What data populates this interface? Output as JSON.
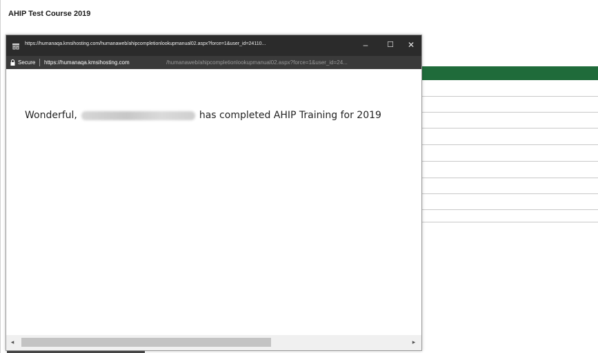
{
  "page": {
    "title": "AHIP Test Course 2019"
  },
  "popup": {
    "titlebar_url": "https://humanaqa.kmsihosting.com/humanaweb/ahipcompletionlookupmanual02.aspx?force=1&user_id=24110...",
    "minimize_glyph": "–",
    "maximize_glyph": "☐",
    "close_glyph": "✕",
    "secure_label": "Secure",
    "address_host": "https://humanaqa.kmsihosting.com",
    "address_path": "/humanaweb/ahipcompletionlookupmanual02.aspx?force=1&user_id=24...",
    "message_prefix": "Wonderful,",
    "message_suffix": "has completed AHIP Training for 2019"
  },
  "scrollbar": {
    "left_arrow": "◂",
    "right_arrow": "▸"
  },
  "colors": {
    "titlebar": "#2b2b2b",
    "addressbar": "#3a3a3a",
    "accent_green": "#1f6b3a"
  },
  "icons": {
    "titlebar": "page-icon",
    "address": "lock-icon"
  }
}
